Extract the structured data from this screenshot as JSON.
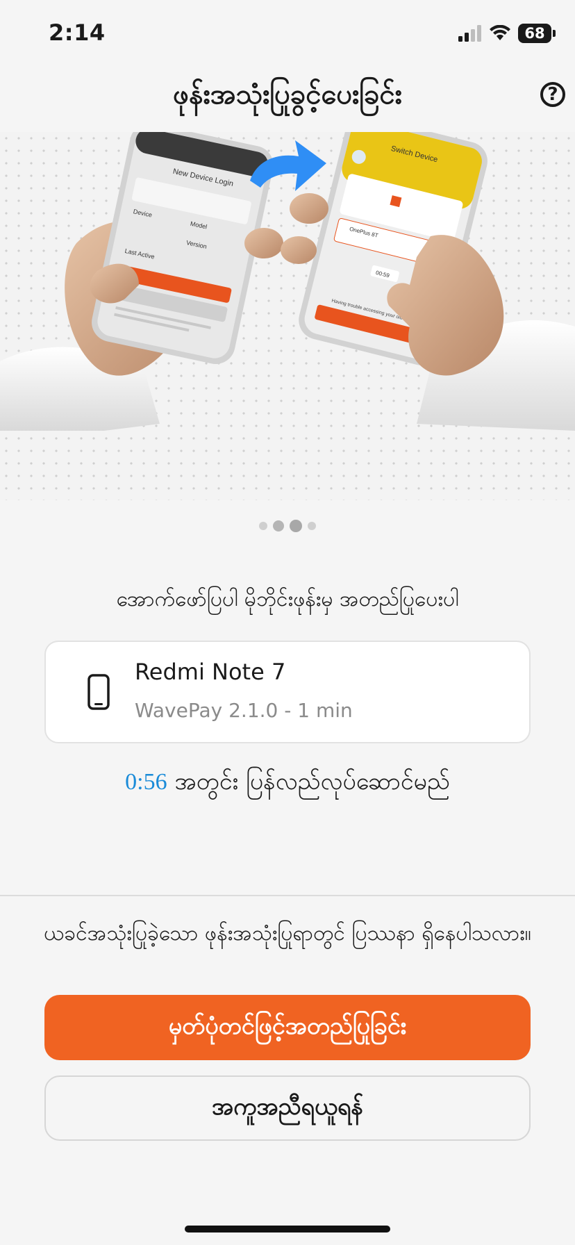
{
  "status_bar": {
    "time": "2:14",
    "battery": "68",
    "icons": [
      "signal-icon",
      "wifi-icon",
      "battery-icon"
    ]
  },
  "header": {
    "title": "ဖုန်းအသုံးပြုခွင့်ပေးခြင်း",
    "help_icon": "?"
  },
  "hero": {
    "left_phone_title": "New Device Login",
    "left_phone_labels": [
      "Device",
      "Model",
      "Version",
      "Last Active"
    ],
    "right_phone_title": "Switch Device",
    "right_phone_device": "OnePlus 8T",
    "right_phone_timer": "00:59",
    "right_phone_trouble": "Having trouble accessing your old device?"
  },
  "pager": {
    "count": 4,
    "active_index": 2
  },
  "approve_prompt": "အောက်ဖော်ပြပါ မိုဘိုင်းဖုန်းမှ အတည်ပြုပေးပါ",
  "device": {
    "name": "Redmi Note 7",
    "meta": "WavePay 2.1.0  -  1 min",
    "icon": "smartphone-icon"
  },
  "countdown": {
    "time": "0:56",
    "text": "အတွင်း ပြန်လည်လုပ်ဆောင်မည်"
  },
  "trouble_text": "ယခင်အသုံးပြုခဲ့သော ဖုန်းအသုံးပြုရာတွင် ပြဿနာ ရှိနေပါသလား။",
  "buttons": {
    "primary": "မှတ်ပုံတင်ဖြင့်အတည်ပြုခြင်း",
    "secondary": "အကူအညီရယူရန်"
  },
  "colors": {
    "accent": "#f06322",
    "timer": "#1a8bd8",
    "background": "#f5f5f5"
  }
}
